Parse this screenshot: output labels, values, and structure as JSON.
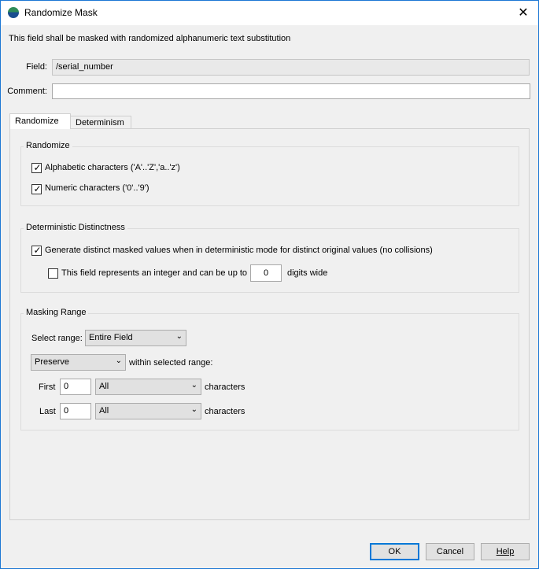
{
  "window": {
    "title": "Randomize Mask",
    "close_glyph": "✕"
  },
  "description": "This field shall be masked with randomized alphanumeric text substitution",
  "field": {
    "label": "Field:",
    "value": "/serial_number"
  },
  "comment": {
    "label": "Comment:",
    "value": ""
  },
  "tabs": [
    {
      "label": "Randomize"
    },
    {
      "label": "Determinism"
    }
  ],
  "randomize_group": {
    "title": "Randomize",
    "alphabetic": {
      "label": "Alphabetic characters ('A'..'Z','a..'z')",
      "checked": true
    },
    "numeric": {
      "label": "Numeric characters ('0'..'9')",
      "checked": true
    }
  },
  "distinctness_group": {
    "title": "Deterministic Distinctness",
    "generate_distinct": {
      "label": "Generate distinct masked values when in deterministic mode for distinct original values (no collisions)",
      "checked": true
    },
    "integer": {
      "label": "This field represents an integer and can be up to",
      "checked": false,
      "digits_value": "0",
      "suffix": "digits wide"
    }
  },
  "masking_range_group": {
    "title": "Masking Range",
    "select_range_label": "Select range:",
    "select_range_value": "Entire Field",
    "mode_value": "Preserve",
    "mode_suffix": "within selected range:",
    "first": {
      "label": "First",
      "count": "0",
      "type": "All",
      "suffix": "characters"
    },
    "last": {
      "label": "Last",
      "count": "0",
      "type": "All",
      "suffix": "characters"
    }
  },
  "buttons": {
    "ok": "OK",
    "cancel": "Cancel",
    "help": "Help"
  },
  "check_glyph": "✓",
  "dropdown_glyph": "⌄",
  "icons": {
    "app": "app-globe-icon",
    "close": "close-icon",
    "checkbox": "check-icon",
    "dropdown": "chevron-down-icon"
  }
}
